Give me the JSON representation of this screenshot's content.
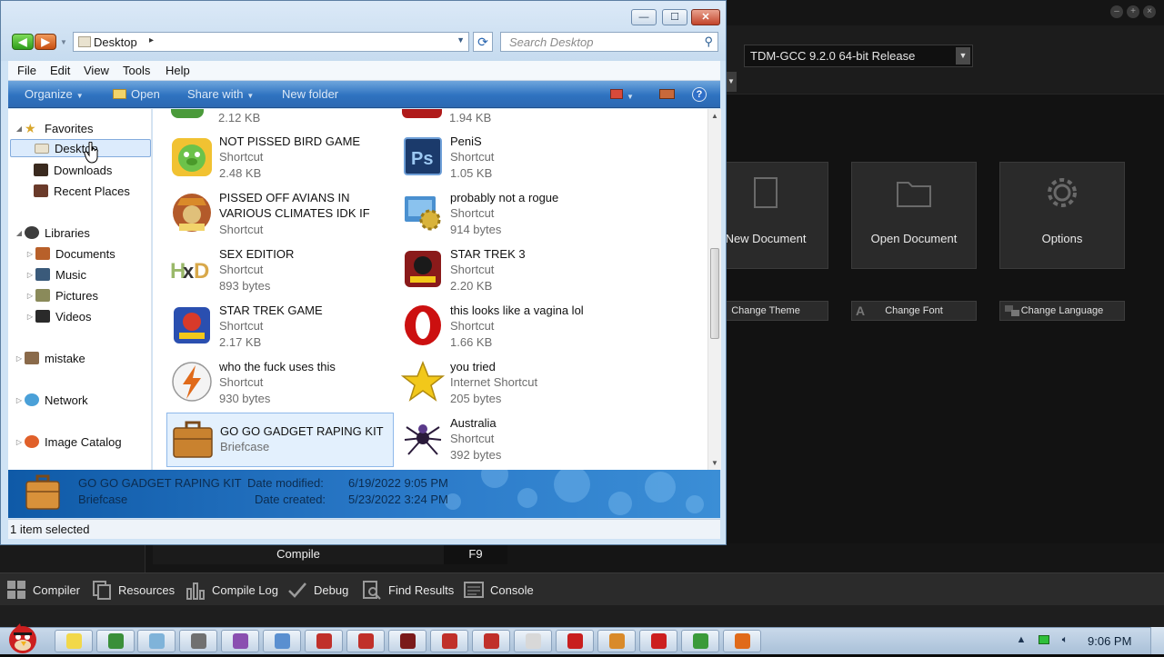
{
  "ide": {
    "compiler_select": "TDM-GCC 9.2.0 64-bit Release",
    "tiles": [
      {
        "label": "New Document",
        "icon": "document-icon"
      },
      {
        "label": "Open Document",
        "icon": "folder-icon"
      },
      {
        "label": "Options",
        "icon": "gear-icon"
      }
    ],
    "small_buttons": [
      {
        "label": "Change Theme",
        "icon": "theme-icon"
      },
      {
        "label": "Change Font",
        "icon": "font-icon"
      },
      {
        "label": "Change Language",
        "icon": "language-icon"
      }
    ],
    "compile_label": "Compile",
    "compile_shortcut": "F9",
    "bottom_tabs": [
      {
        "label": "Compiler",
        "icon": "compiler-icon"
      },
      {
        "label": "Resources",
        "icon": "resources-icon"
      },
      {
        "label": "Compile Log",
        "icon": "chart-icon"
      },
      {
        "label": "Debug",
        "icon": "check-icon"
      },
      {
        "label": "Find Results",
        "icon": "find-icon"
      },
      {
        "label": "Console",
        "icon": "console-icon"
      }
    ]
  },
  "explorer": {
    "window_buttons": {
      "minimize": "—",
      "maximize": "☐",
      "close": "✕"
    },
    "address": {
      "location": "Desktop",
      "separator": "▸"
    },
    "search_placeholder": "Search Desktop",
    "menus": [
      "File",
      "Edit",
      "View",
      "Tools",
      "Help"
    ],
    "commands": {
      "organize": "Organize",
      "open": "Open",
      "share_with": "Share with",
      "new_folder": "New folder"
    },
    "nav": {
      "favorites": "Favorites",
      "desktop": "Desktop",
      "downloads": "Downloads",
      "recent_places": "Recent Places",
      "libraries": "Libraries",
      "documents": "Documents",
      "music": "Music",
      "pictures": "Pictures",
      "videos": "Videos",
      "mistake": "mistake",
      "network": "Network",
      "image_catalog": "Image Catalog"
    },
    "partial_sizes": [
      "2.12 KB",
      "1.94 KB"
    ],
    "files": [
      {
        "name": "NOT PISSED BIRD GAME",
        "type": "Shortcut",
        "size": "2.48 KB",
        "icon": "green-pig-game-icon",
        "color": "#6cc24a"
      },
      {
        "name": "PeniS",
        "type": "Shortcut",
        "size": "1.05 KB",
        "icon": "photoshop-icon",
        "color": "#1b3a6b"
      },
      {
        "name": "PISSED OFF AVIANS IN VARIOUS CLIMATES IDK IF TH...",
        "type": "Shortcut",
        "size": "",
        "icon": "angry-birds-seasons-icon",
        "color": "#b35a2a"
      },
      {
        "name": "probably not a rogue",
        "type": "Shortcut",
        "size": "914 bytes",
        "icon": "gears-icon",
        "color": "#d9b33a"
      },
      {
        "name": "SEX EDITIOR",
        "type": "Shortcut",
        "size": "893 bytes",
        "icon": "hxd-editor-icon",
        "color": "#6f8f3a"
      },
      {
        "name": "STAR TREK 3",
        "type": "Shortcut",
        "size": "2.20 KB",
        "icon": "star-wars-game-icon",
        "color": "#8a1a1a"
      },
      {
        "name": "STAR TREK GAME",
        "type": "Shortcut",
        "size": "2.17 KB",
        "icon": "star-wars-game-icon",
        "color": "#2a4fb0"
      },
      {
        "name": "this looks like a vagina lol",
        "type": "Shortcut",
        "size": "1.66 KB",
        "icon": "opera-icon",
        "color": "#cc1010"
      },
      {
        "name": "who the fuck uses this",
        "type": "Shortcut",
        "size": "930 bytes",
        "icon": "winamp-lightning-icon",
        "color": "#e06a1a"
      },
      {
        "name": "you tried",
        "type": "Internet Shortcut",
        "size": "205 bytes",
        "icon": "star-icon",
        "color": "#f2c81a"
      },
      {
        "name": "GO GO GADGET RAPING KIT",
        "type": "Briefcase",
        "size": "",
        "icon": "briefcase-icon",
        "color": "#c9822f"
      },
      {
        "name": "Australia",
        "type": "Shortcut",
        "size": "392 bytes",
        "icon": "spider-solitaire-icon",
        "color": "#5a3a8a"
      }
    ],
    "details": {
      "name": "GO GO GADGET RAPING KIT",
      "type": "Briefcase",
      "modified_label": "Date modified:",
      "modified": "6/19/2022 9:05 PM",
      "created_label": "Date created:",
      "created": "5/23/2022 3:24 PM"
    },
    "status": "1 item selected"
  },
  "taskbar": {
    "clock": "9:06 PM",
    "buttons": [
      {
        "icon": "sticky-notes-icon",
        "color": "#f2d84a"
      },
      {
        "icon": "chrome-icon",
        "color": "#3a8f3a"
      },
      {
        "icon": "notepad-icon",
        "color": "#7fb3d9"
      },
      {
        "icon": "settings-icon",
        "color": "#707070"
      },
      {
        "icon": "purple-app-icon",
        "color": "#8a4fb0"
      },
      {
        "icon": "bird-app-icon",
        "color": "#5a8fd0"
      },
      {
        "icon": "red-bird-icon",
        "color": "#c0302a"
      },
      {
        "icon": "red-bird-icon",
        "color": "#c0302a"
      },
      {
        "icon": "dark-red-app-icon",
        "color": "#7a1a1a"
      },
      {
        "icon": "red-bird-icon",
        "color": "#c0302a"
      },
      {
        "icon": "red-bird-icon",
        "color": "#c0302a"
      },
      {
        "icon": "card-app-icon",
        "color": "#d8d8d8"
      },
      {
        "icon": "flash-icon",
        "color": "#c81e1e"
      },
      {
        "icon": "torch-icon",
        "color": "#d98a2a"
      },
      {
        "icon": "dev-app-icon",
        "color": "#cc1f1f"
      },
      {
        "icon": "shield-icon",
        "color": "#3a9a3a"
      },
      {
        "icon": "firefox-icon",
        "color": "#e06a1a"
      }
    ]
  }
}
